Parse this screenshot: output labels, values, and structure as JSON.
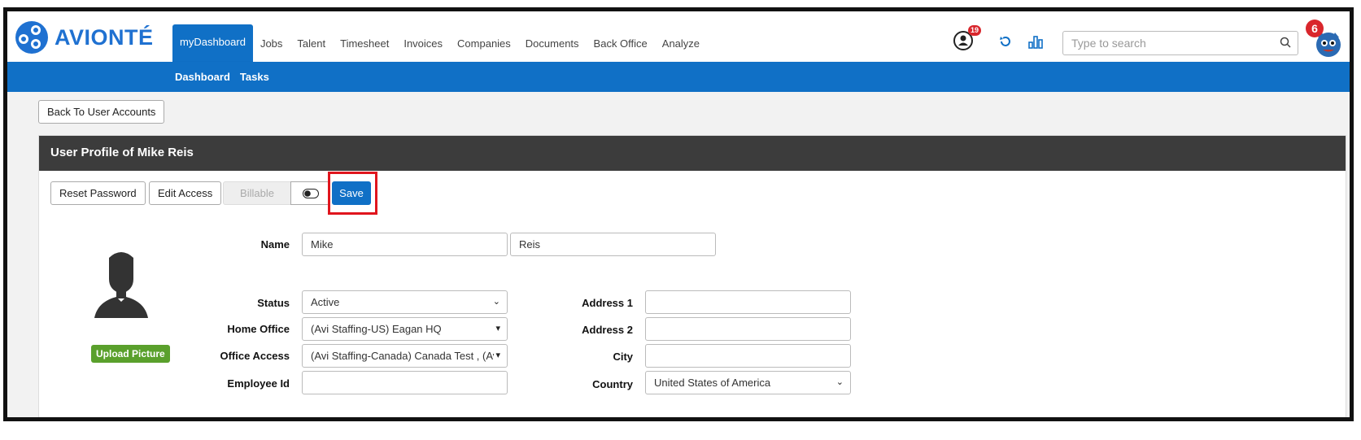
{
  "brand": {
    "name": "AVIONTÉ"
  },
  "nav": {
    "items": [
      {
        "label": "myDashboard",
        "active": true
      },
      {
        "label": "Jobs"
      },
      {
        "label": "Talent"
      },
      {
        "label": "Timesheet"
      },
      {
        "label": "Invoices"
      },
      {
        "label": "Companies"
      },
      {
        "label": "Documents"
      },
      {
        "label": "Back Office"
      },
      {
        "label": "Analyze"
      }
    ],
    "subitems": [
      "Dashboard",
      "Tasks"
    ]
  },
  "header": {
    "notification_count": "19",
    "avatar_badge": "6",
    "search_placeholder": "Type to search"
  },
  "page": {
    "back_button": "Back To User Accounts",
    "panel_title": "User Profile of Mike Reis",
    "toolbar": {
      "reset_password": "Reset Password",
      "edit_access": "Edit Access",
      "billable": "Billable",
      "save": "Save"
    },
    "upload_picture": "Upload Picture"
  },
  "form": {
    "name_label": "Name",
    "first_name": "Mike",
    "last_name": "Reis",
    "status_label": "Status",
    "status_value": "Active",
    "home_office_label": "Home Office",
    "home_office_value": "(Avi Staffing-US) Eagan HQ",
    "office_access_label": "Office Access",
    "office_access_value": "(Avi Staffing-Canada) Canada Test , (Av",
    "employee_id_label": "Employee Id",
    "employee_id_value": "",
    "address1_label": "Address 1",
    "address1_value": "",
    "address2_label": "Address 2",
    "address2_value": "",
    "city_label": "City",
    "city_value": "",
    "country_label": "Country",
    "country_value": "United States of America"
  },
  "colors": {
    "brand_blue": "#1070c6",
    "panel_header": "#3c3c3c",
    "upload_green": "#5aa02c",
    "highlight_red": "#e0151d",
    "badge_red": "#d9262c"
  }
}
